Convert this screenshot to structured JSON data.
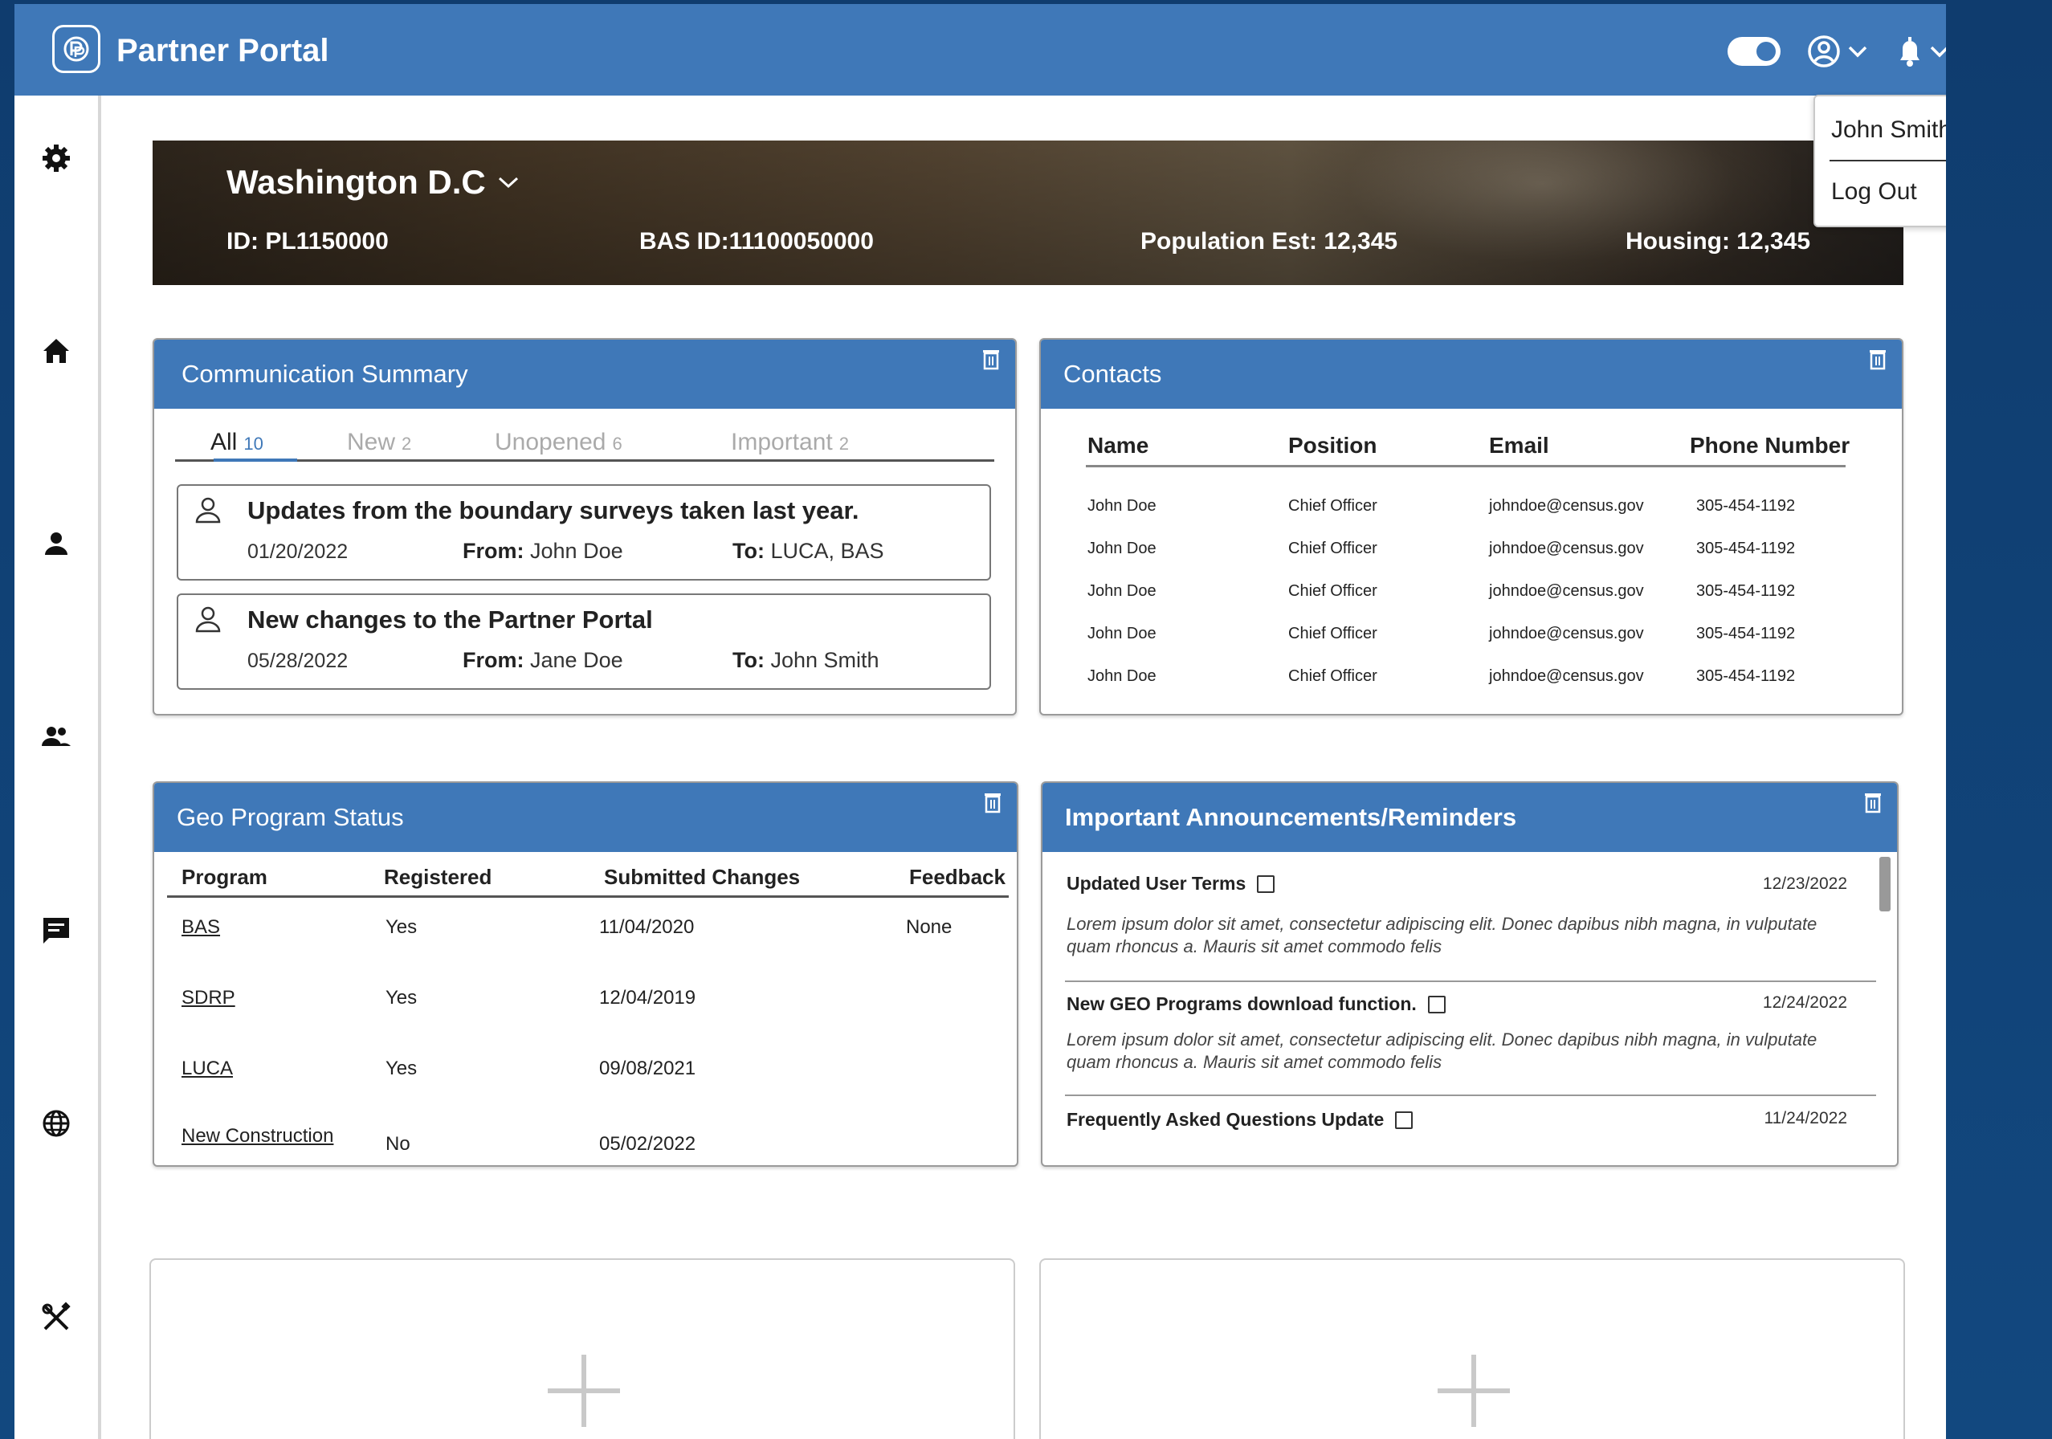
{
  "app": {
    "title": "Partner Portal",
    "colors": {
      "primary": "#3f78b8",
      "background": "#0f3c6e"
    }
  },
  "header": {
    "toggle_icon": "toggle-switch-icon",
    "account_icon": "user-circle-icon",
    "notification_icon": "bell-icon"
  },
  "user_menu": {
    "name": "John Smith",
    "logout_label": "Log Out"
  },
  "left_sidebar": [
    "settings-icon",
    "home-icon",
    "person-icon",
    "group-icon",
    "chat-icon",
    "globe-icon",
    "tools-icon"
  ],
  "right_sidebar": [
    "help-icon",
    "bookmark-icon",
    "contact-card-icon"
  ],
  "banner": {
    "location": "Washington D.C",
    "id": "ID: PL1150000",
    "bas_id": "BAS ID:11100050000",
    "population": "Population Est: 12,345",
    "housing": "Housing: 12,345"
  },
  "communication": {
    "title": "Communication Summary",
    "tabs": [
      {
        "label": "All",
        "count": "10"
      },
      {
        "label": "New",
        "count": "2"
      },
      {
        "label": "Unopened",
        "count": "6"
      },
      {
        "label": "Important",
        "count": "2"
      }
    ],
    "from_label": "From:",
    "to_label": "To:",
    "messages": [
      {
        "subject": "Updates from the boundary surveys taken last year.",
        "date": "01/20/2022",
        "from": "John Doe",
        "to": "LUCA, BAS"
      },
      {
        "subject": "New changes to the Partner Portal",
        "date": "05/28/2022",
        "from": "Jane Doe",
        "to": "John Smith"
      }
    ]
  },
  "contacts": {
    "title": "Contacts",
    "columns": [
      "Name",
      "Position",
      "Email",
      "Phone Number"
    ],
    "rows": [
      [
        "John Doe",
        "Chief Officer",
        "johndoe@census.gov",
        "305-454-1192"
      ],
      [
        "John Doe",
        "Chief Officer",
        "johndoe@census.gov",
        "305-454-1192"
      ],
      [
        "John Doe",
        "Chief Officer",
        "johndoe@census.gov",
        "305-454-1192"
      ],
      [
        "John Doe",
        "Chief Officer",
        "johndoe@census.gov",
        "305-454-1192"
      ],
      [
        "John Doe",
        "Chief Officer",
        "johndoe@census.gov",
        "305-454-1192"
      ]
    ]
  },
  "geo": {
    "title": "Geo Program Status",
    "columns": [
      "Program",
      "Registered",
      "Submitted Changes",
      "Feedback"
    ],
    "rows": [
      [
        "BAS",
        "Yes",
        "11/04/2020",
        "None"
      ],
      [
        "SDRP",
        "Yes",
        "12/04/2019",
        ""
      ],
      [
        "LUCA",
        "Yes",
        "09/08/2021",
        ""
      ],
      [
        "New Construction",
        "No",
        "05/02/2022",
        ""
      ]
    ]
  },
  "announcements": {
    "title": "Important Announcements/Reminders",
    "items": [
      {
        "title": "Updated User Terms",
        "date": "12/23/2022",
        "body": "Lorem ipsum dolor sit amet, consectetur adipiscing elit. Donec dapibus nibh magna, in vulputate quam rhoncus a. Mauris sit amet commodo felis"
      },
      {
        "title": "New GEO Programs download function.",
        "date": "12/24/2022",
        "body": "Lorem ipsum dolor sit amet, consectetur adipiscing elit. Donec dapibus nibh magna, in vulputate quam rhoncus a. Mauris sit amet commodo felis"
      },
      {
        "title": "Frequently Asked Questions Update",
        "date": "11/24/2022",
        "body": ""
      }
    ]
  }
}
